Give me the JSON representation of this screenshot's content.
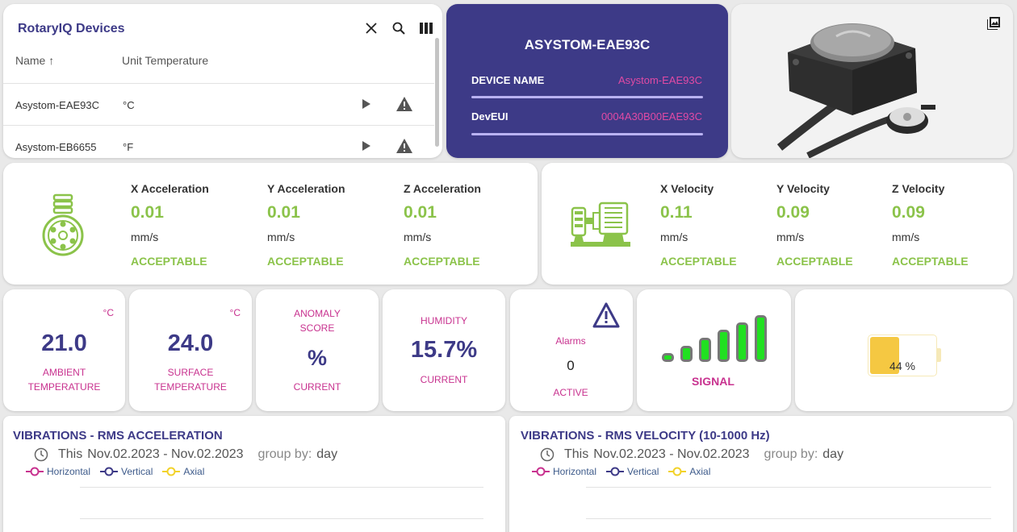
{
  "devices": {
    "title": "RotaryIQ Devices",
    "columns": [
      "Name ↑",
      "Unit Temperature"
    ],
    "rows": [
      {
        "name": "Asystom-EAE93C",
        "unit": "°C"
      },
      {
        "name": "Asystom-EB6655",
        "unit": "°F"
      }
    ]
  },
  "device_info": {
    "title": "ASYSTOM-EAE93C",
    "name_label": "DEVICE NAME",
    "name_value": "Asystom-EAE93C",
    "eui_label": "DevEUI",
    "eui_value": "0004A30B00EAE93C"
  },
  "acceleration": [
    {
      "title": "X Acceleration",
      "value": "0.01",
      "unit": "mm/s",
      "status": "ACCEPTABLE"
    },
    {
      "title": "Y Acceleration",
      "value": "0.01",
      "unit": "mm/s",
      "status": "ACCEPTABLE"
    },
    {
      "title": "Z Acceleration",
      "value": "0.01",
      "unit": "mm/s",
      "status": "ACCEPTABLE"
    }
  ],
  "velocity": [
    {
      "title": "X Velocity",
      "value": "0.11",
      "unit": "mm/s",
      "status": "ACCEPTABLE"
    },
    {
      "title": "Y Velocity",
      "value": "0.09",
      "unit": "mm/s",
      "status": "ACCEPTABLE"
    },
    {
      "title": "Z Velocity",
      "value": "0.09",
      "unit": "mm/s",
      "status": "ACCEPTABLE"
    }
  ],
  "tiles": {
    "ambient": {
      "unit": "°C",
      "value": "21.0",
      "label1": "AMBIENT",
      "label2": "TEMPERATURE"
    },
    "surface": {
      "unit": "°C",
      "value": "24.0",
      "label1": "SURFACE",
      "label2": "TEMPERATURE"
    },
    "anomaly": {
      "label1": "ANOMALY",
      "label2": "SCORE",
      "value": "%",
      "sub": "CURRENT"
    },
    "humidity": {
      "label": "HUMIDITY",
      "value": "15.7%",
      "sub": "CURRENT"
    },
    "alarms": {
      "label": "Alarms",
      "value": "0",
      "sub": "ACTIVE"
    },
    "signal": {
      "label": "SIGNAL",
      "bars": 6
    },
    "battery": {
      "percent_text": "44 %",
      "level": 0.44
    }
  },
  "panels": [
    {
      "title": "VIBRATIONS - RMS ACCELERATION",
      "range_prefix": "This",
      "range": "Nov.02.2023 - Nov.02.2023",
      "groupby_label": "group by:",
      "groupby": "day",
      "legend": [
        "Horizontal",
        "Vertical",
        "Axial"
      ]
    },
    {
      "title": "VIBRATIONS - RMS VELOCITY (10-1000 Hz)",
      "range_prefix": "This",
      "range": "Nov.02.2023 - Nov.02.2023",
      "groupby_label": "group by:",
      "groupby": "day",
      "legend": [
        "Horizontal",
        "Vertical",
        "Axial"
      ]
    }
  ],
  "colors": {
    "primary": "#3d3a87",
    "accent": "#c8328f",
    "ok": "#8bc34a",
    "signal": "#21e021",
    "battery": "#f5c842"
  }
}
